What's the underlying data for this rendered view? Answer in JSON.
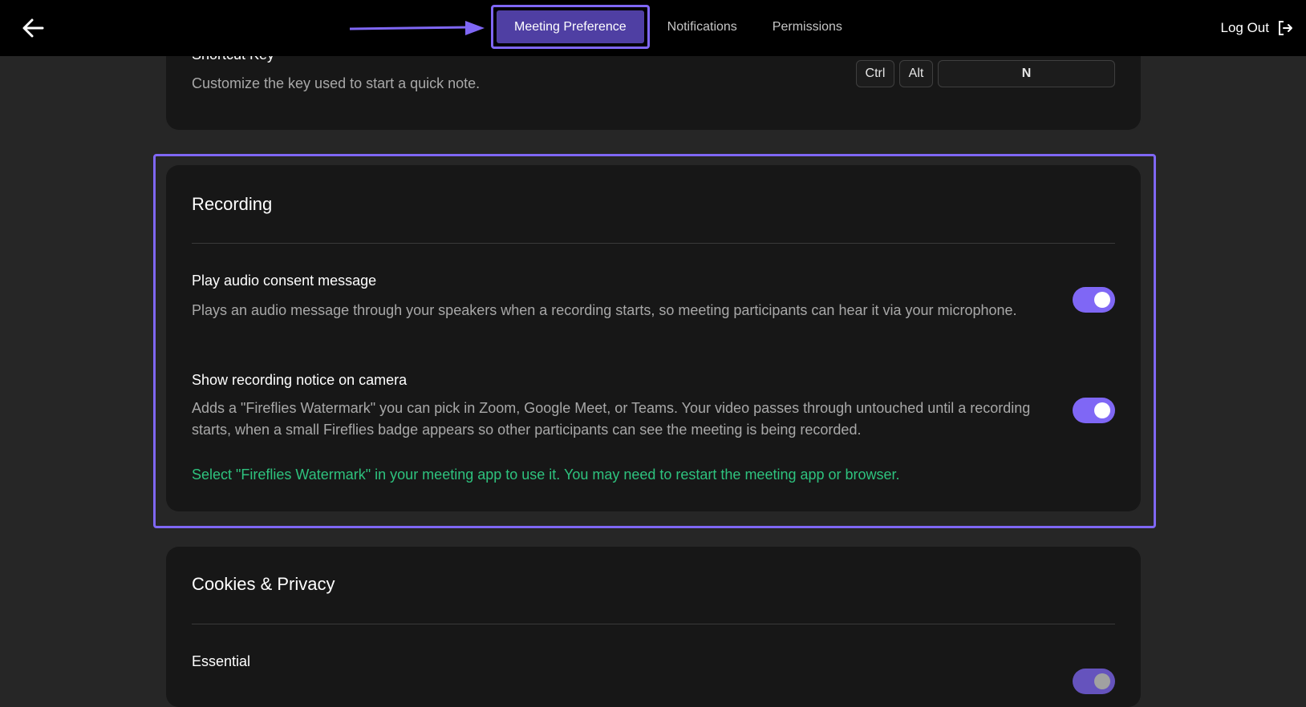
{
  "header": {
    "tabs": [
      {
        "label": "Meeting Preference",
        "active": true
      },
      {
        "label": "Notifications",
        "active": false
      },
      {
        "label": "Permissions",
        "active": false
      }
    ],
    "logout_label": "Log Out"
  },
  "shortcut": {
    "title": "Shortcut Key",
    "description": "Customize the key used to start a quick note.",
    "keys": [
      "Ctrl",
      "Alt",
      "N"
    ]
  },
  "recording": {
    "title": "Recording",
    "settings": [
      {
        "title": "Play audio consent message",
        "description": "Plays an audio message through your speakers when a recording starts, so meeting participants can hear it via your microphone.",
        "enabled": true
      },
      {
        "title": "Show recording notice on camera",
        "description": "Adds a \"Fireflies Watermark\" you can pick in Zoom, Google Meet, or Teams. Your video passes through untouched until a recording starts, when a small Fireflies badge appears so other participants can see the meeting is being recorded.",
        "enabled": true
      }
    ],
    "note": "Select \"Fireflies Watermark\" in your meeting app to use it. You may need to restart the meeting app or browser."
  },
  "cookies": {
    "title": "Cookies & Privacy",
    "settings": [
      {
        "title": "Essential",
        "enabled": true
      }
    ]
  },
  "colors": {
    "accent": "#7f67f5",
    "active_tab": "#4f3fa3",
    "note_green": "#2ec27e",
    "background": "#262626",
    "card": "#171717"
  }
}
